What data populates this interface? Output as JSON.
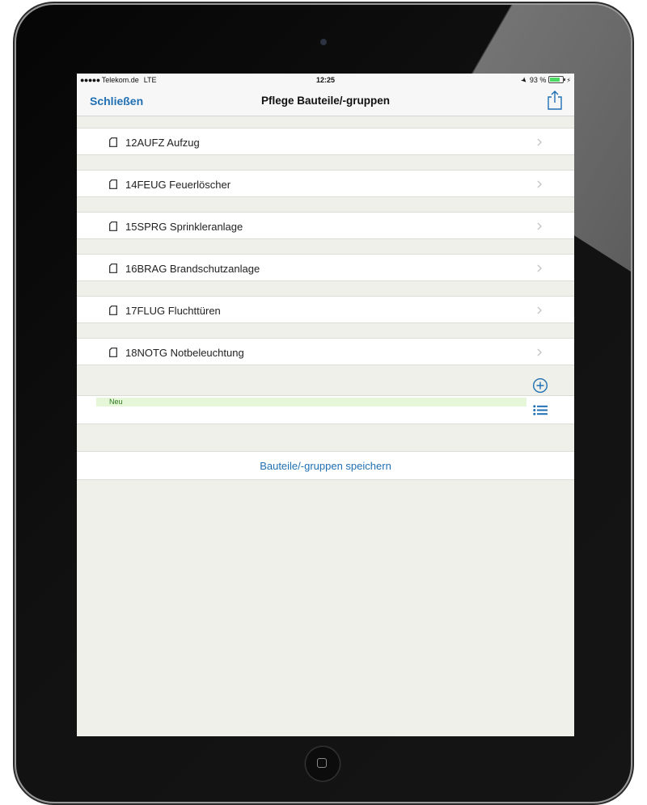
{
  "status_bar": {
    "signal": "●●●●●",
    "carrier": "Telekom.de",
    "network": "LTE",
    "time": "12:25",
    "battery": "93 %",
    "battery_level": 0.93,
    "battery_color": "#4cd964"
  },
  "nav": {
    "close_label": "Schließen",
    "title": "Pflege Bauteile/-gruppen",
    "share_icon": "share-icon"
  },
  "items": [
    {
      "label": "12AUFZ Aufzug"
    },
    {
      "label": "14FEUG Feuerlöscher"
    },
    {
      "label": "15SPRG Sprinkleranlage"
    },
    {
      "label": "16BRAG Brandschutzanlage"
    },
    {
      "label": "17FLUG Fluchttüren"
    },
    {
      "label": "18NOTG Notbeleuchtung"
    }
  ],
  "new_entry": {
    "placeholder": "Neu",
    "add_icon": "plus-circle-icon",
    "list_icon": "list-icon"
  },
  "save": {
    "label": "Bauteile/-gruppen speichern"
  },
  "colors": {
    "accent": "#1f6fb3",
    "background": "#eff0ea",
    "new_field": "#e5f7d8"
  }
}
